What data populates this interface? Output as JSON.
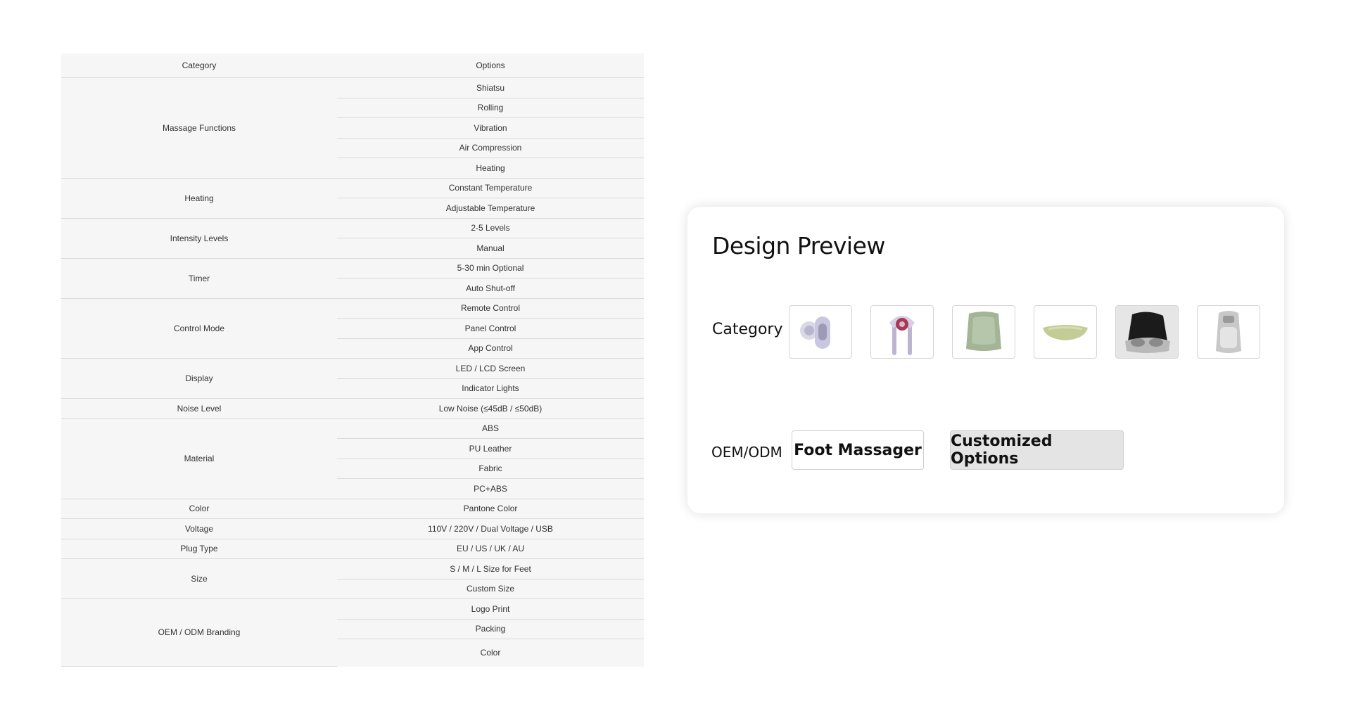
{
  "spec_table": {
    "header": {
      "category": "Category",
      "options": "Options"
    },
    "groups": [
      {
        "category": "Massage Functions",
        "options": [
          "Shiatsu",
          "Rolling",
          "Vibration",
          "Air Compression",
          "Heating"
        ]
      },
      {
        "category": "Heating",
        "options": [
          "Constant Temperature",
          "Adjustable Temperature"
        ]
      },
      {
        "category": "Intensity Levels",
        "options": [
          "2-5 Levels",
          "Manual"
        ]
      },
      {
        "category": "Timer",
        "options": [
          "5-30 min Optional",
          "Auto Shut-off"
        ]
      },
      {
        "category": "Control Mode",
        "options": [
          "Remote Control",
          "Panel Control",
          "App Control"
        ]
      },
      {
        "category": "Display",
        "options": [
          "LED / LCD Screen",
          "Indicator Lights"
        ]
      },
      {
        "category": "Noise Level",
        "options": [
          "Low Noise (≤45dB / ≤50dB)"
        ]
      },
      {
        "category": "Material",
        "options": [
          "ABS",
          "PU Leather",
          "Fabric",
          "PC+ABS"
        ]
      },
      {
        "category": "Color",
        "options": [
          "Pantone Color"
        ]
      },
      {
        "category": "Voltage",
        "options": [
          "110V / 220V / Dual Voltage / USB"
        ]
      },
      {
        "category": "Plug Type",
        "options": [
          "EU / US / UK / AU"
        ]
      },
      {
        "category": "Size",
        "options": [
          "S / M / L Size for Feet",
          "Custom Size"
        ]
      },
      {
        "category": "OEM / ODM Branding",
        "options": [
          "Logo Print",
          "Packing",
          "Color"
        ]
      }
    ]
  },
  "preview": {
    "title": "Design Preview",
    "category_label": "Category",
    "thumbnails": [
      {
        "name": "massage-gun-thumbnail",
        "icon": "massage-gun-icon",
        "selected": false
      },
      {
        "name": "neck-shoulder-massager-thumbnail",
        "icon": "neck-massager-icon",
        "selected": false
      },
      {
        "name": "back-cushion-massager-thumbnail",
        "icon": "back-cushion-icon",
        "selected": false
      },
      {
        "name": "neck-pillow-massager-thumbnail",
        "icon": "neck-pillow-icon",
        "selected": false
      },
      {
        "name": "foot-massager-thumbnail",
        "icon": "foot-massager-icon",
        "selected": true
      },
      {
        "name": "leg-massager-thumbnail",
        "icon": "leg-massager-icon",
        "selected": false
      }
    ],
    "oem_label": "OEM/ODM",
    "buttons": {
      "product": "Foot Massager",
      "customize": "Customized Options"
    }
  },
  "colors": {
    "table_bg": "#f6f6f6",
    "row_border": "#dadada",
    "card_bg": "#ffffff",
    "selected_bg": "#e6e6e6",
    "sage_green": "#a3b596",
    "lavender": "#c9c7e0"
  }
}
